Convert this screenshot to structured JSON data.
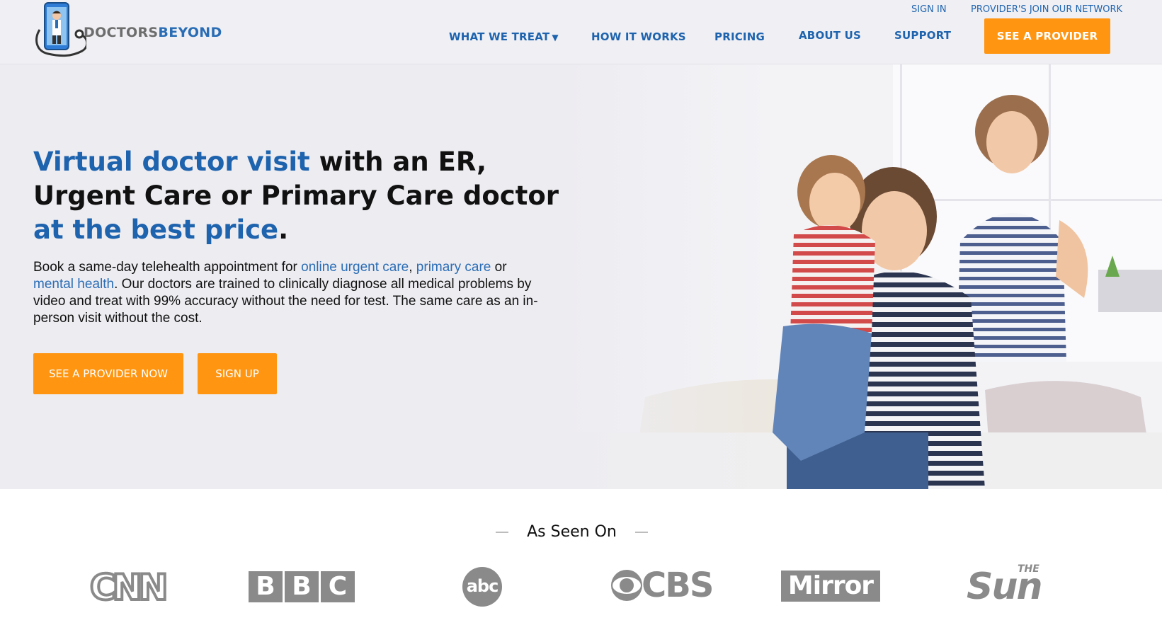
{
  "brand": {
    "name_part1": "DOCTORS",
    "name_part2": "BEYOND",
    "logo_icon": "doctor-phone-stethoscope-icon"
  },
  "top_links": {
    "sign_in": "SIGN IN",
    "providers_join": "PROVIDER'S JOIN OUR NETWORK"
  },
  "nav": {
    "items": [
      {
        "label": "WHAT WE TREAT",
        "caret": "▼"
      },
      {
        "label": "HOW IT WORKS"
      },
      {
        "label": "PRICING"
      },
      {
        "label": "ABOUT US"
      },
      {
        "label": "SUPPORT"
      }
    ],
    "cta": "SEE A PROVIDER"
  },
  "hero": {
    "headline": {
      "p1": "Virtual doctor visit",
      "p2": " with an ER, Urgent Care or Primary Care doctor ",
      "p3": "at the best price",
      "p4": "."
    },
    "body": {
      "t1": "Book a same-day telehealth appointment for ",
      "link1": "online urgent care",
      "t2": ", ",
      "link2": "primary care",
      "t3": " or ",
      "link3": "mental health",
      "t4": ". Our doctors are trained to clinically diagnose all medical problems by video and treat with 99% accuracy without the need for test. The same care as an in-person visit without the cost."
    },
    "primary_button": "SEE A PROVIDER NOW",
    "secondary_button": "SIGN UP"
  },
  "as_seen_on": {
    "title": "As Seen On",
    "logos": {
      "cnn": "CNN",
      "bbc": [
        "B",
        "B",
        "C"
      ],
      "abc": "abc",
      "cbs": "CBS",
      "mirror": "Mirror",
      "sun_the": "THE",
      "sun": "Sun"
    }
  },
  "colors": {
    "accent_blue": "#1e63ae",
    "cta_orange": "#ff9511",
    "logo_gray": "#8a8a8a"
  }
}
